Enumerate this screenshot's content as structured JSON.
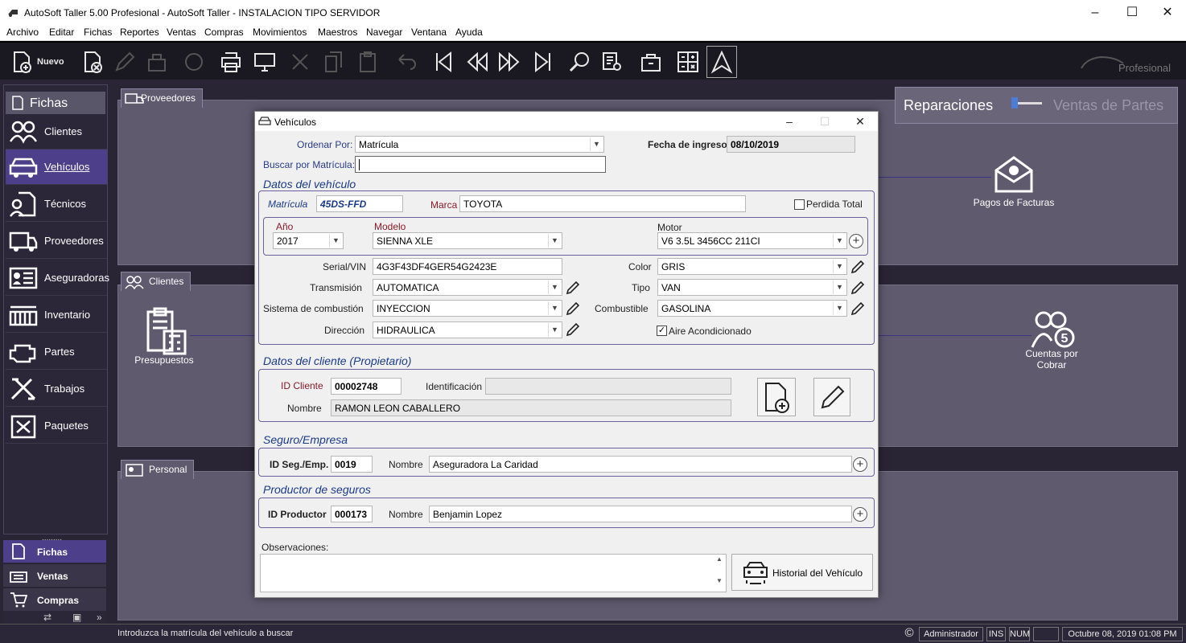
{
  "window": {
    "title": "AutoSoft Taller 5.00 Profesional - AutoSoft Taller - INSTALACION TIPO SERVIDOR"
  },
  "menu": [
    "Archivo",
    "Editar",
    "Fichas",
    "Reportes",
    "Ventas",
    "Compras",
    "Movimientos",
    "Maestros",
    "Navegar",
    "Ventana",
    "Ayuda"
  ],
  "toolbar": {
    "new_label": "Nuevo",
    "brand": "Profesional"
  },
  "sidebar": {
    "title": "Fichas",
    "items": [
      "Clientes",
      "Vehículos",
      "Técnicos",
      "Proveedores",
      "Aseguradoras",
      "Inventario",
      "Partes",
      "Trabajos",
      "Paquetes"
    ],
    "bottom_tabs": [
      "Fichas",
      "Ventas",
      "Compras"
    ]
  },
  "main": {
    "toggle": {
      "left": "Reparaciones",
      "right": "Ventas de Partes"
    },
    "panels": {
      "proveedores": "Proveedores",
      "clientes": "Clientes",
      "personal": "Personal"
    },
    "icons": {
      "pagos": "Pagos de Facturas",
      "presupuestos": "Presupuestos",
      "cuentas": "Cuentas por Cobrar"
    }
  },
  "dialog": {
    "title": "Vehículos",
    "ordenar_label": "Ordenar Por:",
    "ordenar_value": "Matrícula",
    "fecha_label": "Fecha de ingreso",
    "fecha_value": "08/10/2019",
    "buscar_label": "Buscar por Matrícula:",
    "buscar_value": "",
    "sec_vehiculo": "Datos del vehículo",
    "matricula_label": "Matrícula",
    "matricula_value": "45DS-FFD",
    "marca_label": "Marca",
    "marca_value": "TOYOTA",
    "perdida_label": "Perdida Total",
    "perdida_checked": false,
    "anio_label": "Año",
    "anio_value": "2017",
    "modelo_label": "Modelo",
    "modelo_value": "SIENNA XLE",
    "motor_label": "Motor",
    "motor_value": "V6 3.5L 3456CC 211CI",
    "serial_label": "Serial/VIN",
    "serial_value": "4G3F43DF4GER54G2423E",
    "color_label": "Color",
    "color_value": "GRIS",
    "transmision_label": "Transmisión",
    "transmision_value": "AUTOMATICA",
    "tipo_label": "Tipo",
    "tipo_value": "VAN",
    "combustion_label": "Sistema de combustión",
    "combustion_value": "INYECCION",
    "combustible_label": "Combustible",
    "combustible_value": "GASOLINA",
    "direccion_label": "Dirección",
    "direccion_value": "HIDRAULICA",
    "aire_label": "Aire Acondicionado",
    "aire_checked": true,
    "sec_cliente": "Datos del cliente (Propietario)",
    "idcliente_label": "ID Cliente",
    "idcliente_value": "00002748",
    "identificacion_label": "Identificación",
    "identificacion_value": "",
    "nombre_label": "Nombre",
    "nombre_value": "RAMON LEON CABALLERO",
    "sec_seguro": "Seguro/Empresa",
    "idseg_label": "ID Seg./Emp.",
    "idseg_value": "0019",
    "seg_nombre_label": "Nombre",
    "seg_nombre_value": "Aseguradora La Caridad",
    "sec_productor": "Productor de seguros",
    "idprod_label": "ID Productor",
    "idprod_value": "000173",
    "prod_nombre_label": "Nombre",
    "prod_nombre_value": "Benjamin Lopez",
    "obs_label": "Observaciones:",
    "obs_value": "",
    "historial_label": "Historial del Vehículo"
  },
  "status": {
    "message": "Introduzca la matrícula del vehículo a buscar",
    "user": "Administrador",
    "ins": "INS",
    "num": "NUM",
    "datetime": "Octubre 08, 2019 01:08 PM"
  }
}
